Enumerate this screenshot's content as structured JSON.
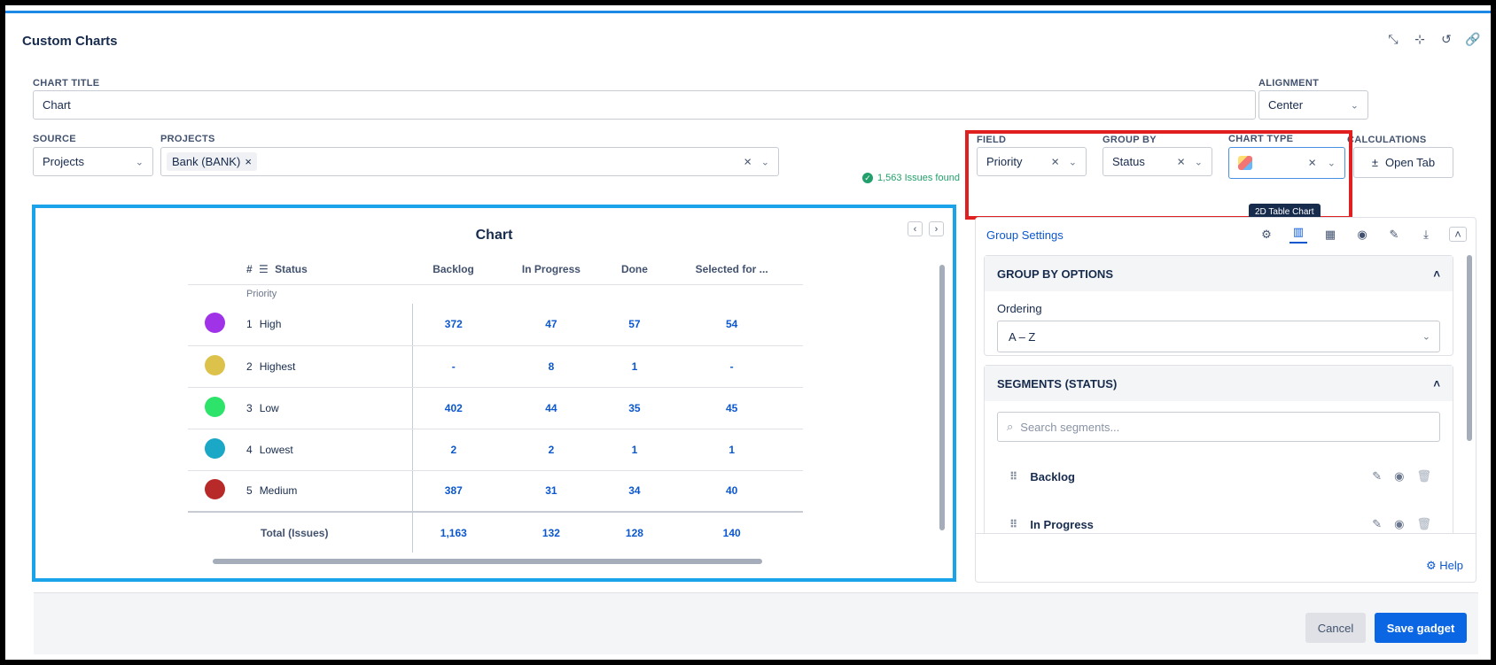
{
  "window": {
    "title": "Custom Charts"
  },
  "header_icons": [
    "collapse-icon",
    "minimize-icon",
    "refresh-icon",
    "link-icon"
  ],
  "form": {
    "chart_title_label": "CHART TITLE",
    "chart_title_value": "Chart",
    "alignment_label": "ALIGNMENT",
    "alignment_value": "Center",
    "source_label": "SOURCE",
    "source_value": "Projects",
    "projects_label": "PROJECTS",
    "project_tag": "Bank (BANK)",
    "issues_found": "1,563 Issues found",
    "field_label": "FIELD",
    "field_value": "Priority",
    "group_by_label": "GROUP BY",
    "group_by_value": "Status",
    "chart_type_label": "CHART TYPE",
    "chart_type_tooltip": "2D Table Chart",
    "calculations_label": "CALCULATIONS",
    "open_tab_label": "Open Tab"
  },
  "chart": {
    "title": "Chart",
    "col_hash": "#",
    "col_status": "Status",
    "columns": [
      "Backlog",
      "In Progress",
      "Done",
      "Selected for ..."
    ],
    "row_group_label": "Priority",
    "rows": [
      {
        "index": "1",
        "name": "High",
        "color": "#a033e8",
        "values": [
          "372",
          "47",
          "57",
          "54"
        ]
      },
      {
        "index": "2",
        "name": "Highest",
        "color": "#dcc24a",
        "values": [
          "-",
          "8",
          "1",
          "-"
        ]
      },
      {
        "index": "3",
        "name": "Low",
        "color": "#2ee36a",
        "values": [
          "402",
          "44",
          "35",
          "45"
        ]
      },
      {
        "index": "4",
        "name": "Lowest",
        "color": "#1ba7c6",
        "values": [
          "2",
          "2",
          "1",
          "1"
        ]
      },
      {
        "index": "5",
        "name": "Medium",
        "color": "#b82a2a",
        "values": [
          "387",
          "31",
          "34",
          "40"
        ]
      }
    ],
    "total_label": "Total (Issues)",
    "totals": [
      "1,163",
      "132",
      "128",
      "140"
    ]
  },
  "panel": {
    "title": "Group Settings",
    "group_by_options": "GROUP BY OPTIONS",
    "ordering_label": "Ordering",
    "ordering_value": "A – Z",
    "segments_label": "SEGMENTS (STATUS)",
    "search_placeholder": "Search segments...",
    "segments": [
      "Backlog",
      "In Progress"
    ],
    "help": "Help"
  },
  "footer": {
    "cancel": "Cancel",
    "save": "Save gadget"
  }
}
